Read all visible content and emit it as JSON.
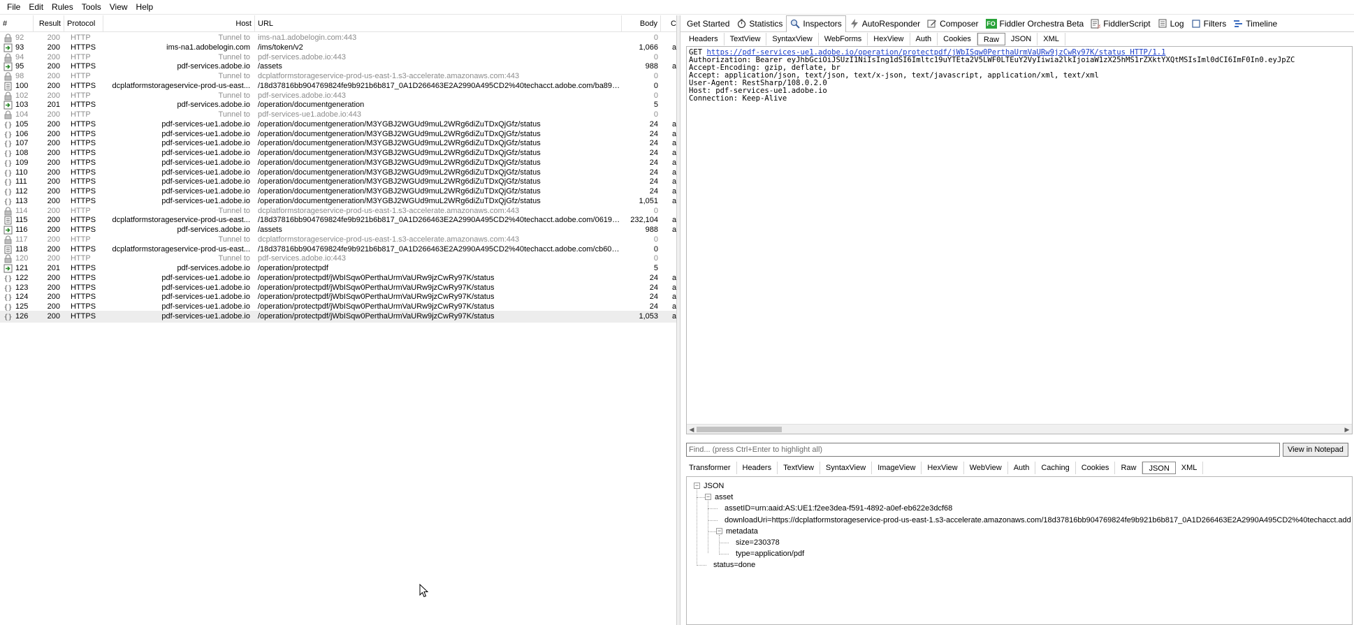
{
  "menu": [
    "File",
    "Edit",
    "Rules",
    "Tools",
    "View",
    "Help"
  ],
  "columns": {
    "num": "#",
    "result": "Result",
    "protocol": "Protocol",
    "host": "Host",
    "url": "URL",
    "body": "Body",
    "caching": "C"
  },
  "sessions": [
    {
      "num": "92",
      "result": "200",
      "protocol": "HTTP",
      "host": "Tunnel to",
      "url": "ims-na1.adobelogin.com:443",
      "body": "0",
      "cc": "",
      "icon": "lock-icon",
      "tunnel": true
    },
    {
      "num": "93",
      "result": "200",
      "protocol": "HTTPS",
      "host": "ims-na1.adobelogin.com",
      "url": "/ims/token/v2",
      "body": "1,066",
      "cc": "a",
      "icon": "json-response-icon",
      "tunnel": false
    },
    {
      "num": "94",
      "result": "200",
      "protocol": "HTTP",
      "host": "Tunnel to",
      "url": "pdf-services.adobe.io:443",
      "body": "0",
      "cc": "",
      "icon": "lock-icon",
      "tunnel": true
    },
    {
      "num": "95",
      "result": "200",
      "protocol": "HTTPS",
      "host": "pdf-services.adobe.io",
      "url": "/assets",
      "body": "988",
      "cc": "a",
      "icon": "json-response-icon",
      "tunnel": false
    },
    {
      "num": "98",
      "result": "200",
      "protocol": "HTTP",
      "host": "Tunnel to",
      "url": "dcplatformstorageservice-prod-us-east-1.s3-accelerate.amazonaws.com:443",
      "body": "0",
      "cc": "",
      "icon": "lock-icon",
      "tunnel": true
    },
    {
      "num": "100",
      "result": "200",
      "protocol": "HTTPS",
      "host": "dcplatformstorageservice-prod-us-east...",
      "url": "/18d37816bb904769824fe9b921b6b817_0A1D266463E2A2990A495CD2%40techacct.adobe.com/ba89c...",
      "body": "0",
      "cc": "",
      "icon": "document-icon",
      "tunnel": false
    },
    {
      "num": "102",
      "result": "200",
      "protocol": "HTTP",
      "host": "Tunnel to",
      "url": "pdf-services.adobe.io:443",
      "body": "0",
      "cc": "",
      "icon": "lock-icon",
      "tunnel": true
    },
    {
      "num": "103",
      "result": "201",
      "protocol": "HTTPS",
      "host": "pdf-services.adobe.io",
      "url": "/operation/documentgeneration",
      "body": "5",
      "cc": "",
      "icon": "json-response-icon",
      "tunnel": false
    },
    {
      "num": "104",
      "result": "200",
      "protocol": "HTTP",
      "host": "Tunnel to",
      "url": "pdf-services-ue1.adobe.io:443",
      "body": "0",
      "cc": "",
      "icon": "lock-icon",
      "tunnel": true
    },
    {
      "num": "105",
      "result": "200",
      "protocol": "HTTPS",
      "host": "pdf-services-ue1.adobe.io",
      "url": "/operation/documentgeneration/M3YGBJ2WGUd9muL2WRg6diZuTDxQjGfz/status",
      "body": "24",
      "cc": "a",
      "icon": "json-braces-icon",
      "tunnel": false
    },
    {
      "num": "106",
      "result": "200",
      "protocol": "HTTPS",
      "host": "pdf-services-ue1.adobe.io",
      "url": "/operation/documentgeneration/M3YGBJ2WGUd9muL2WRg6diZuTDxQjGfz/status",
      "body": "24",
      "cc": "a",
      "icon": "json-braces-icon",
      "tunnel": false
    },
    {
      "num": "107",
      "result": "200",
      "protocol": "HTTPS",
      "host": "pdf-services-ue1.adobe.io",
      "url": "/operation/documentgeneration/M3YGBJ2WGUd9muL2WRg6diZuTDxQjGfz/status",
      "body": "24",
      "cc": "a",
      "icon": "json-braces-icon",
      "tunnel": false
    },
    {
      "num": "108",
      "result": "200",
      "protocol": "HTTPS",
      "host": "pdf-services-ue1.adobe.io",
      "url": "/operation/documentgeneration/M3YGBJ2WGUd9muL2WRg6diZuTDxQjGfz/status",
      "body": "24",
      "cc": "a",
      "icon": "json-braces-icon",
      "tunnel": false
    },
    {
      "num": "109",
      "result": "200",
      "protocol": "HTTPS",
      "host": "pdf-services-ue1.adobe.io",
      "url": "/operation/documentgeneration/M3YGBJ2WGUd9muL2WRg6diZuTDxQjGfz/status",
      "body": "24",
      "cc": "a",
      "icon": "json-braces-icon",
      "tunnel": false
    },
    {
      "num": "110",
      "result": "200",
      "protocol": "HTTPS",
      "host": "pdf-services-ue1.adobe.io",
      "url": "/operation/documentgeneration/M3YGBJ2WGUd9muL2WRg6diZuTDxQjGfz/status",
      "body": "24",
      "cc": "a",
      "icon": "json-braces-icon",
      "tunnel": false
    },
    {
      "num": "111",
      "result": "200",
      "protocol": "HTTPS",
      "host": "pdf-services-ue1.adobe.io",
      "url": "/operation/documentgeneration/M3YGBJ2WGUd9muL2WRg6diZuTDxQjGfz/status",
      "body": "24",
      "cc": "a",
      "icon": "json-braces-icon",
      "tunnel": false
    },
    {
      "num": "112",
      "result": "200",
      "protocol": "HTTPS",
      "host": "pdf-services-ue1.adobe.io",
      "url": "/operation/documentgeneration/M3YGBJ2WGUd9muL2WRg6diZuTDxQjGfz/status",
      "body": "24",
      "cc": "a",
      "icon": "json-braces-icon",
      "tunnel": false
    },
    {
      "num": "113",
      "result": "200",
      "protocol": "HTTPS",
      "host": "pdf-services-ue1.adobe.io",
      "url": "/operation/documentgeneration/M3YGBJ2WGUd9muL2WRg6diZuTDxQjGfz/status",
      "body": "1,051",
      "cc": "a",
      "icon": "json-braces-icon",
      "tunnel": false
    },
    {
      "num": "114",
      "result": "200",
      "protocol": "HTTP",
      "host": "Tunnel to",
      "url": "dcplatformstorageservice-prod-us-east-1.s3-accelerate.amazonaws.com:443",
      "body": "0",
      "cc": "",
      "icon": "lock-icon",
      "tunnel": true
    },
    {
      "num": "115",
      "result": "200",
      "protocol": "HTTPS",
      "host": "dcplatformstorageservice-prod-us-east...",
      "url": "/18d37816bb904769824fe9b921b6b817_0A1D266463E2A2990A495CD2%40techacct.adobe.com/06190...",
      "body": "232,104",
      "cc": "a",
      "icon": "document-icon",
      "tunnel": false
    },
    {
      "num": "116",
      "result": "200",
      "protocol": "HTTPS",
      "host": "pdf-services.adobe.io",
      "url": "/assets",
      "body": "988",
      "cc": "a",
      "icon": "json-response-icon",
      "tunnel": false
    },
    {
      "num": "117",
      "result": "200",
      "protocol": "HTTP",
      "host": "Tunnel to",
      "url": "dcplatformstorageservice-prod-us-east-1.s3-accelerate.amazonaws.com:443",
      "body": "0",
      "cc": "",
      "icon": "lock-icon",
      "tunnel": true
    },
    {
      "num": "118",
      "result": "200",
      "protocol": "HTTPS",
      "host": "dcplatformstorageservice-prod-us-east...",
      "url": "/18d37816bb904769824fe9b921b6b817_0A1D266463E2A2990A495CD2%40techacct.adobe.com/cb60a...",
      "body": "0",
      "cc": "",
      "icon": "document-icon",
      "tunnel": false
    },
    {
      "num": "120",
      "result": "200",
      "protocol": "HTTP",
      "host": "Tunnel to",
      "url": "pdf-services.adobe.io:443",
      "body": "0",
      "cc": "",
      "icon": "lock-icon",
      "tunnel": true
    },
    {
      "num": "121",
      "result": "201",
      "protocol": "HTTPS",
      "host": "pdf-services.adobe.io",
      "url": "/operation/protectpdf",
      "body": "5",
      "cc": "",
      "icon": "json-response-icon",
      "tunnel": false
    },
    {
      "num": "122",
      "result": "200",
      "protocol": "HTTPS",
      "host": "pdf-services-ue1.adobe.io",
      "url": "/operation/protectpdf/jWbISqw0PerthaUrmVaURw9jzCwRy97K/status",
      "body": "24",
      "cc": "a",
      "icon": "json-braces-icon",
      "tunnel": false
    },
    {
      "num": "123",
      "result": "200",
      "protocol": "HTTPS",
      "host": "pdf-services-ue1.adobe.io",
      "url": "/operation/protectpdf/jWbISqw0PerthaUrmVaURw9jzCwRy97K/status",
      "body": "24",
      "cc": "a",
      "icon": "json-braces-icon",
      "tunnel": false
    },
    {
      "num": "124",
      "result": "200",
      "protocol": "HTTPS",
      "host": "pdf-services-ue1.adobe.io",
      "url": "/operation/protectpdf/jWbISqw0PerthaUrmVaURw9jzCwRy97K/status",
      "body": "24",
      "cc": "a",
      "icon": "json-braces-icon",
      "tunnel": false
    },
    {
      "num": "125",
      "result": "200",
      "protocol": "HTTPS",
      "host": "pdf-services-ue1.adobe.io",
      "url": "/operation/protectpdf/jWbISqw0PerthaUrmVaURw9jzCwRy97K/status",
      "body": "24",
      "cc": "a",
      "icon": "json-braces-icon",
      "tunnel": false
    },
    {
      "num": "126",
      "result": "200",
      "protocol": "HTTPS",
      "host": "pdf-services-ue1.adobe.io",
      "url": "/operation/protectpdf/jWbISqw0PerthaUrmVaURw9jzCwRy97K/status",
      "body": "1,053",
      "cc": "a",
      "icon": "json-braces-icon",
      "tunnel": false,
      "selected": true
    }
  ],
  "main_tabs": [
    {
      "label": "Get Started",
      "icon": "",
      "active": false
    },
    {
      "label": "Statistics",
      "icon": "stopwatch-icon",
      "active": false
    },
    {
      "label": "Inspectors",
      "icon": "magnifier-icon",
      "active": true
    },
    {
      "label": "AutoResponder",
      "icon": "lightning-icon",
      "active": false
    },
    {
      "label": "Composer",
      "icon": "compose-icon",
      "active": false
    },
    {
      "label": "Fiddler Orchestra Beta",
      "icon": "fo-icon",
      "active": false
    },
    {
      "label": "FiddlerScript",
      "icon": "script-icon",
      "active": false
    },
    {
      "label": "Log",
      "icon": "log-icon",
      "active": false
    },
    {
      "label": "Filters",
      "icon": "checkbox-icon",
      "active": false
    },
    {
      "label": "Timeline",
      "icon": "timeline-icon",
      "active": false
    }
  ],
  "fo_badge": "FO",
  "request_tabs": [
    {
      "label": "Headers",
      "active": false
    },
    {
      "label": "TextView",
      "active": false
    },
    {
      "label": "SyntaxView",
      "active": false
    },
    {
      "label": "WebForms",
      "active": false
    },
    {
      "label": "HexView",
      "active": false
    },
    {
      "label": "Auth",
      "active": false
    },
    {
      "label": "Cookies",
      "active": false
    },
    {
      "label": "Raw",
      "active": true
    },
    {
      "label": "JSON",
      "active": false
    },
    {
      "label": "XML",
      "active": false
    }
  ],
  "raw_request": {
    "method": "GET ",
    "url": "https://pdf-services-ue1.adobe.io/operation/protectpdf/jWbISqw0PerthaUrmVaURw9jzCwRy97K/status HTTP/1.1",
    "headers": [
      "Authorization: Bearer eyJhbGciOiJSUzI1NiIsIng1dSI6Imltc19uYTEta2V5LWF0LTEuY2VyIiwia2lkIjoiaW1zX25hMS1rZXktYXQtMSIsIml0dCI6ImF0In0.eyJpZC",
      "Accept-Encoding: gzip, deflate, br",
      "Accept: application/json, text/json, text/x-json, text/javascript, application/xml, text/xml",
      "User-Agent: RestSharp/108.0.2.0",
      "Host: pdf-services-ue1.adobe.io",
      "Connection: Keep-Alive"
    ]
  },
  "find": {
    "placeholder": "Find... (press Ctrl+Enter to highlight all)",
    "notepad_button": "View in Notepad"
  },
  "response_tabs": [
    {
      "label": "Transformer",
      "active": false
    },
    {
      "label": "Headers",
      "active": false
    },
    {
      "label": "TextView",
      "active": false
    },
    {
      "label": "SyntaxView",
      "active": false
    },
    {
      "label": "ImageView",
      "active": false
    },
    {
      "label": "HexView",
      "active": false
    },
    {
      "label": "WebView",
      "active": false
    },
    {
      "label": "Auth",
      "active": false
    },
    {
      "label": "Caching",
      "active": false
    },
    {
      "label": "Cookies",
      "active": false
    },
    {
      "label": "Raw",
      "active": false
    },
    {
      "label": "JSON",
      "active": true
    },
    {
      "label": "XML",
      "active": false
    }
  ],
  "json_tree": [
    {
      "text": "JSON",
      "depth": 0,
      "expander": "−"
    },
    {
      "text": "asset",
      "depth": 1,
      "expander": "−"
    },
    {
      "text": "assetID=urn:aaid:AS:UE1:f2ee3dea-f591-4892-a0ef-eb622e3dcf68",
      "depth": 2,
      "expander": ""
    },
    {
      "text": "downloadUri=https://dcplatformstorageservice-prod-us-east-1.s3-accelerate.amazonaws.com/18d37816bb904769824fe9b921b6b817_0A1D266463E2A2990A495CD2%40techacct.add",
      "depth": 2,
      "expander": ""
    },
    {
      "text": "metadata",
      "depth": 2,
      "expander": "−"
    },
    {
      "text": "size=230378",
      "depth": 3,
      "expander": ""
    },
    {
      "text": "type=application/pdf",
      "depth": 3,
      "expander": ""
    },
    {
      "text": "status=done",
      "depth": 1,
      "expander": ""
    }
  ]
}
